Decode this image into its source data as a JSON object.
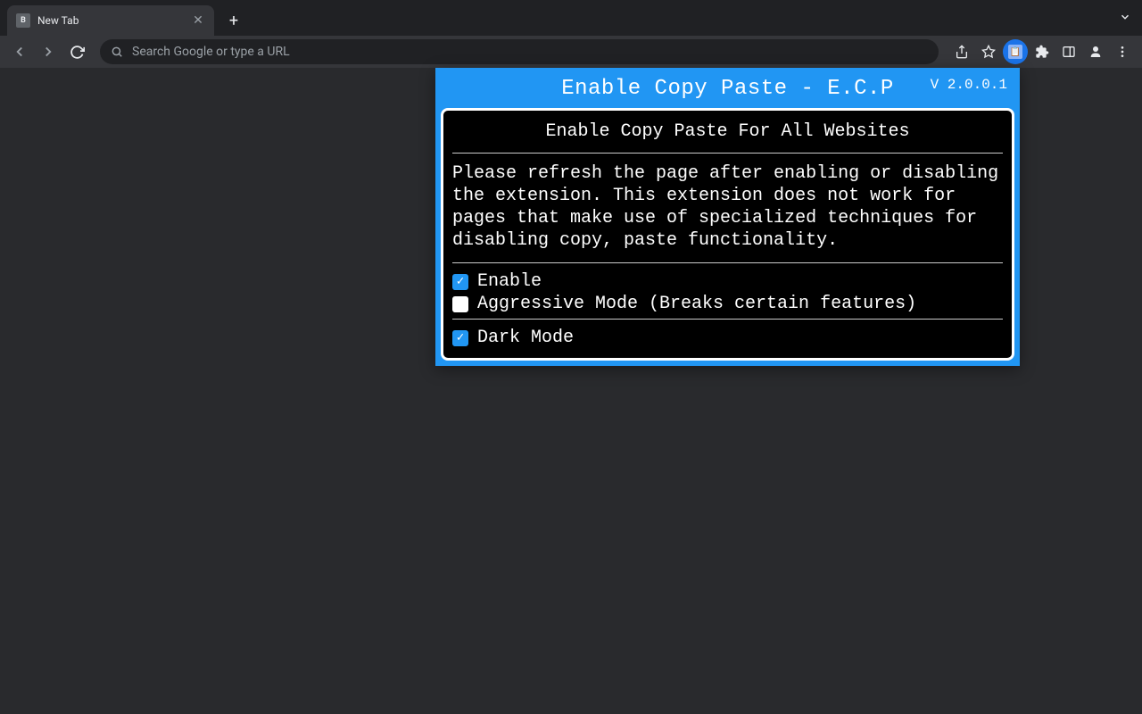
{
  "browser": {
    "tab": {
      "favicon_letter": "B",
      "title": "New Tab"
    },
    "omnibox_placeholder": "Search Google or type a URL"
  },
  "popup": {
    "title": "Enable Copy Paste - E.C.P",
    "version": "V 2.0.0.1",
    "subtitle": "Enable Copy Paste For All Websites",
    "description": "Please refresh the page after enabling or disabling the extension. This extension does not work for pages that make use of specialized techniques for disabling copy, paste functionality.",
    "options": {
      "enable": {
        "label": "Enable",
        "checked": true
      },
      "aggressive": {
        "label": "Aggressive Mode (Breaks certain features)",
        "checked": false
      },
      "dark_mode": {
        "label": "Dark Mode",
        "checked": true
      }
    }
  }
}
